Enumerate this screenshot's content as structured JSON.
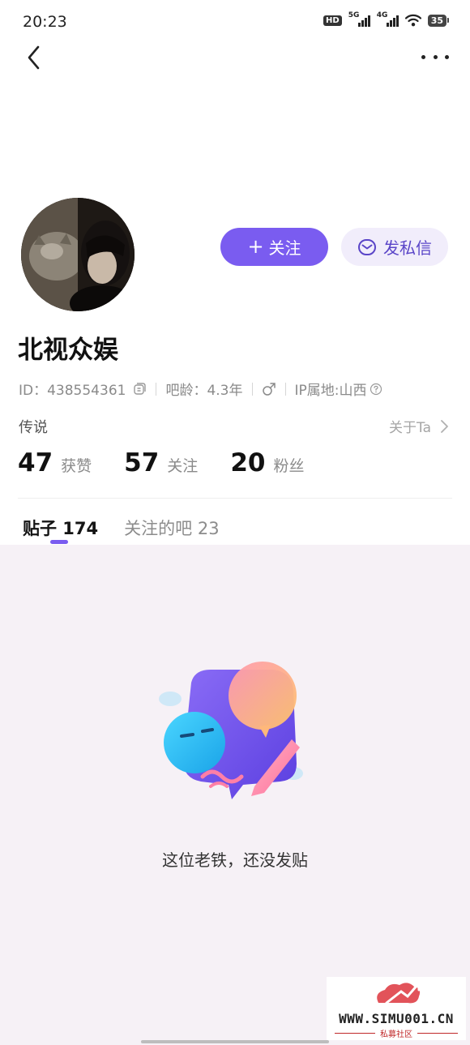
{
  "status_bar": {
    "time": "20:23",
    "hd_label": "HD",
    "net1": "5G",
    "net2": "4G",
    "battery": "35"
  },
  "nav": {
    "back_icon": "chevron-left-icon",
    "more_icon": "more-horizontal-icon"
  },
  "profile": {
    "name": "北视众娱",
    "id_text": "ID：438554361",
    "bar_age": "吧龄：4.3年",
    "gender_icon": "male-icon",
    "ip_location": "IP属地:山西",
    "bio": "传说",
    "about_label": "关于Ta"
  },
  "actions": {
    "follow_label": "关注",
    "message_label": "发私信"
  },
  "stats": [
    {
      "value": "47",
      "label": "获赞"
    },
    {
      "value": "57",
      "label": "关注"
    },
    {
      "value": "20",
      "label": "粉丝"
    }
  ],
  "tabs": [
    {
      "label": "贴子 174",
      "active": true
    },
    {
      "label": "关注的吧 23",
      "active": false
    }
  ],
  "empty_state": {
    "message": "这位老铁，还没发贴"
  },
  "watermark": {
    "url": "WWW.SIMU001.CN",
    "subtitle": "私募社区"
  },
  "colors": {
    "accent": "#7a5cf0",
    "accent_light": "#f1edfb",
    "content_bg": "#f6f1f6"
  }
}
